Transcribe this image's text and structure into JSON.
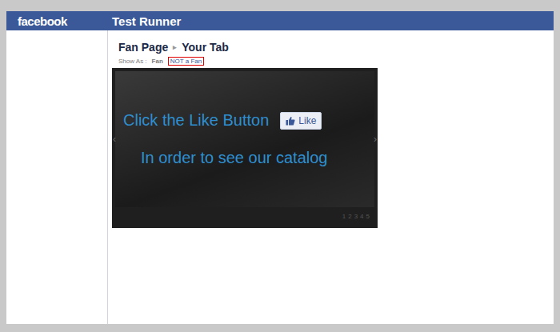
{
  "header": {
    "logo": "facebook",
    "title": "Test Runner"
  },
  "breadcrumb": {
    "items": [
      "Fan Page",
      "Your Tab"
    ],
    "separator": "▸"
  },
  "show_as": {
    "label": "Show As :",
    "options": [
      {
        "label": "Fan",
        "selected": false
      },
      {
        "label": "NOT a Fan",
        "selected": true
      }
    ]
  },
  "banner": {
    "headline": "Click the Like Button",
    "like_button": "Like",
    "subline": "In order to see our catalog",
    "prev": "‹",
    "next": "›",
    "pages": [
      {
        "label": "1",
        "selected": false
      },
      {
        "label": "2",
        "selected": false
      },
      {
        "label": "3",
        "selected": false
      },
      {
        "label": "4",
        "selected": false
      },
      {
        "label": "5",
        "selected": false
      }
    ]
  }
}
